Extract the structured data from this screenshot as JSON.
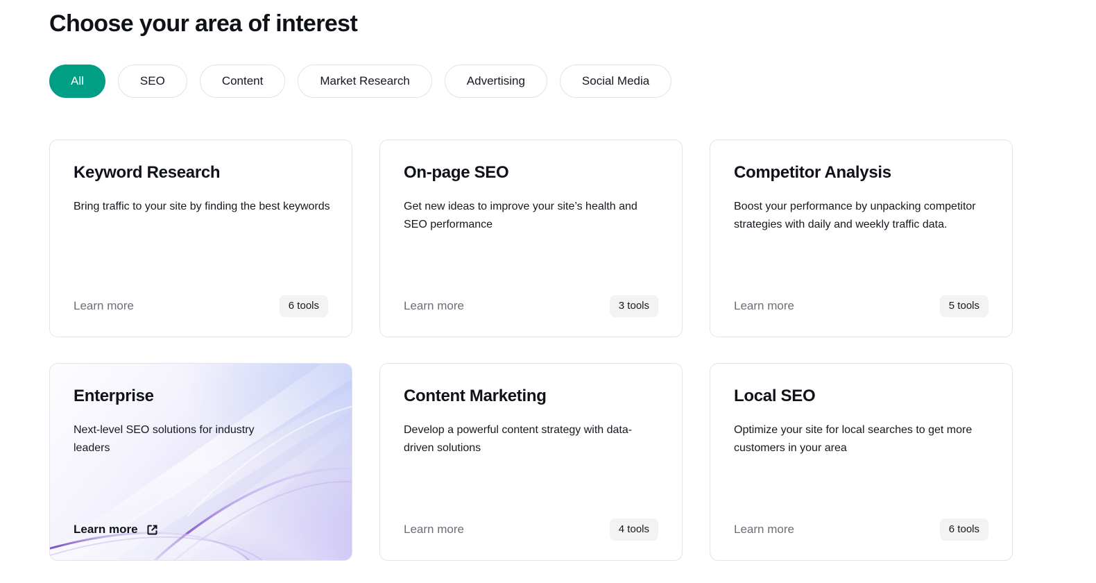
{
  "header": {
    "title": "Choose your area of interest"
  },
  "filters": {
    "items": [
      {
        "label": "All",
        "active": true
      },
      {
        "label": "SEO",
        "active": false
      },
      {
        "label": "Content",
        "active": false
      },
      {
        "label": "Market Research",
        "active": false
      },
      {
        "label": "Advertising",
        "active": false
      },
      {
        "label": "Social Media",
        "active": false
      }
    ],
    "active_color": "#009e84"
  },
  "cards": [
    {
      "title": "Keyword Research",
      "description": "Bring traffic to your site by finding the best keywords",
      "learn_more": "Learn more",
      "tools_badge": "6 tools",
      "featured": false
    },
    {
      "title": "On-page SEO",
      "description": "Get new ideas to improve your site’s health and SEO performance",
      "learn_more": "Learn more",
      "tools_badge": "3 tools",
      "featured": false
    },
    {
      "title": "Competitor Analysis",
      "description": "Boost your performance by unpacking competitor strategies with daily and weekly traffic data.",
      "learn_more": "Learn more",
      "tools_badge": "5 tools",
      "featured": false
    },
    {
      "title": "Enterprise",
      "description": "Next-level SEO solutions for industry leaders",
      "learn_more": "Learn more",
      "tools_badge": "",
      "featured": true,
      "icon": "external-link-icon",
      "accent_color": "#7b4fc9"
    },
    {
      "title": "Content Marketing",
      "description": "Develop a powerful content strategy with data-driven solutions",
      "learn_more": "Learn more",
      "tools_badge": "4 tools",
      "featured": false
    },
    {
      "title": "Local SEO",
      "description": "Optimize your site for local searches to get more customers in your area",
      "learn_more": "Learn more",
      "tools_badge": "6 tools",
      "featured": false
    }
  ]
}
